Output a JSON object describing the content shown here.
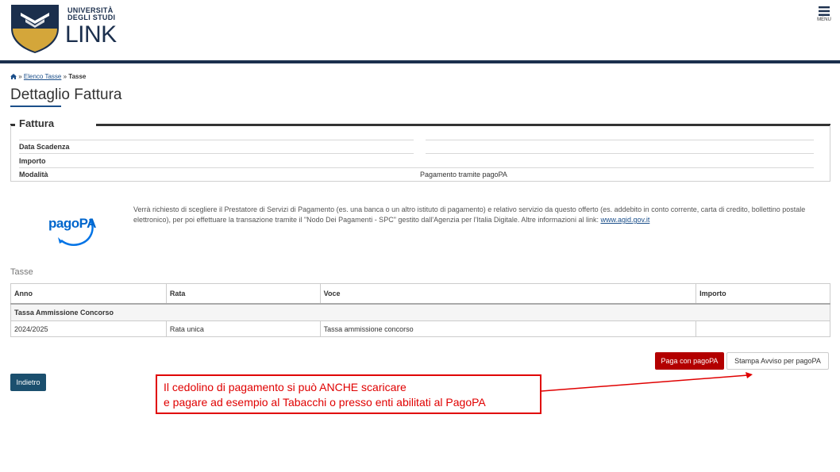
{
  "header": {
    "logo_line1": "UNIVERSITÀ",
    "logo_line2": "DEGLI STUDI",
    "logo_line3": "LINK",
    "menu_label": "MENU",
    "accent_color": "#1b2f4d"
  },
  "breadcrumb": {
    "separator1": "»",
    "link": "Elenco Tasse",
    "separator2": "»",
    "current": "Tasse"
  },
  "page_title": "Dettaglio Fattura",
  "fattura": {
    "title": "Fattura",
    "rows": [
      {
        "label": "Data Scadenza",
        "value": ""
      },
      {
        "label": "Importo",
        "value": ""
      },
      {
        "label": "Modalità",
        "value": "Pagamento tramite pagoPA"
      }
    ]
  },
  "pagopa": {
    "logo_text": "pagoPA",
    "description": "Verrà richiesto di scegliere il Prestatore di Servizi di Pagamento (es. una banca o un altro istituto di pagamento) e relativo servizio da questo offerto (es. addebito in conto corrente, carta di credito, bollettino postale elettronico), per poi effettuare la transazione tramite il \"Nodo Dei Pagamenti - SPC\" gestito dall'Agenzia per l'Italia Digitale. Altre informazioni al link: ",
    "link_text": "www.agid.gov.it"
  },
  "tasse": {
    "label": "Tasse",
    "columns": [
      "Anno",
      "Rata",
      "Voce",
      "Importo"
    ],
    "group": "Tassa Ammissione Concorso",
    "rows": [
      {
        "anno": "2024/2025",
        "rata": "Rata unica",
        "voce": "Tassa ammissione concorso",
        "importo": ""
      }
    ]
  },
  "buttons": {
    "paga": "Paga con pagoPA",
    "stampa": "Stampa Avviso per pagoPA",
    "indietro": "Indietro"
  },
  "annotation": {
    "line1": "Il cedolino di pagamento si può ANCHE scaricare",
    "line2": "e pagare ad esempio al Tabacchi  o presso enti abilitati al PagoPA",
    "color": "#e00000"
  }
}
